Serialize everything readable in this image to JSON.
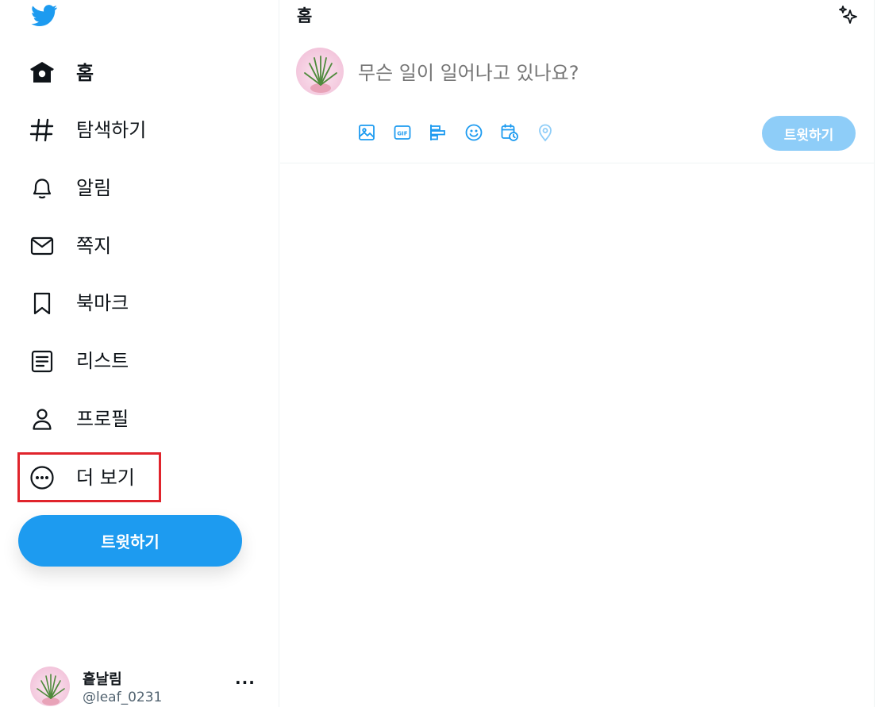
{
  "sidebar": {
    "items": [
      {
        "label": "홈",
        "icon": "home-icon"
      },
      {
        "label": "탐색하기",
        "icon": "hashtag-icon"
      },
      {
        "label": "알림",
        "icon": "bell-icon"
      },
      {
        "label": "쪽지",
        "icon": "envelope-icon"
      },
      {
        "label": "북마크",
        "icon": "bookmark-icon"
      },
      {
        "label": "리스트",
        "icon": "list-icon"
      },
      {
        "label": "프로필",
        "icon": "person-icon"
      },
      {
        "label": "더 보기",
        "icon": "more-circle-icon"
      }
    ],
    "tweet_button": "트윗하기",
    "account": {
      "name": "흩날림",
      "handle": "@leaf_0231",
      "more": "···"
    }
  },
  "main": {
    "title": "홈",
    "composer": {
      "placeholder": "무슨 일이 일어나고 있나요?",
      "tools": [
        "image-icon",
        "gif-icon",
        "poll-icon",
        "emoji-icon",
        "schedule-icon",
        "location-icon"
      ],
      "tweet_button": "트윗하기"
    }
  },
  "colors": {
    "accent": "#1d9bf0",
    "accent_disabled": "#8ecdf8",
    "highlight": "#e0242c",
    "secondary_text": "#536471"
  }
}
